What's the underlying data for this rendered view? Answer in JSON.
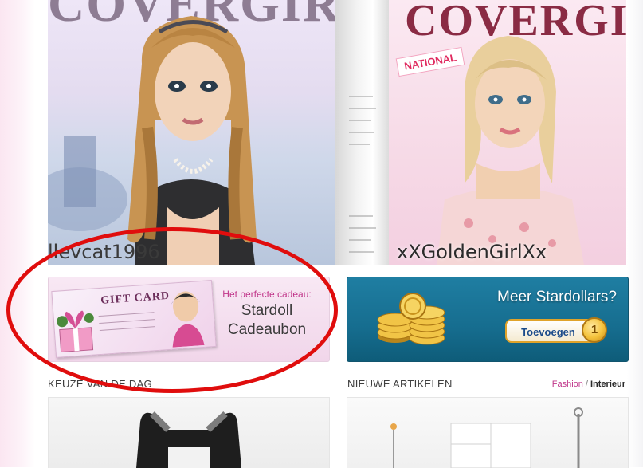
{
  "covers": [
    {
      "masthead": "COVERGIRL",
      "username": "llevcat1996"
    },
    {
      "masthead": "COVERGIRL",
      "tag": "NATIONAL",
      "username": "xXGoldenGirlXx"
    }
  ],
  "promos": {
    "giftcard": {
      "card_title": "GIFT CARD",
      "kicker": "Het perfecte cadeau:",
      "line1": "Stardoll",
      "line2": "Cadeaubon"
    },
    "stardollars": {
      "title": "Meer Stardollars?",
      "button_label": "Toevoegen",
      "badge": "1"
    }
  },
  "sections": {
    "left_heading": "KEUZE VAN DE DAG",
    "right_heading": "NIEUWE ARTIKELEN",
    "filter_fashion": "Fashion",
    "filter_sep": "/",
    "filter_interieur": "Interieur"
  },
  "colors": {
    "highlight": "#e00d0d",
    "link_pink": "#c0368a",
    "stardollar_blue": "#166d8f"
  }
}
